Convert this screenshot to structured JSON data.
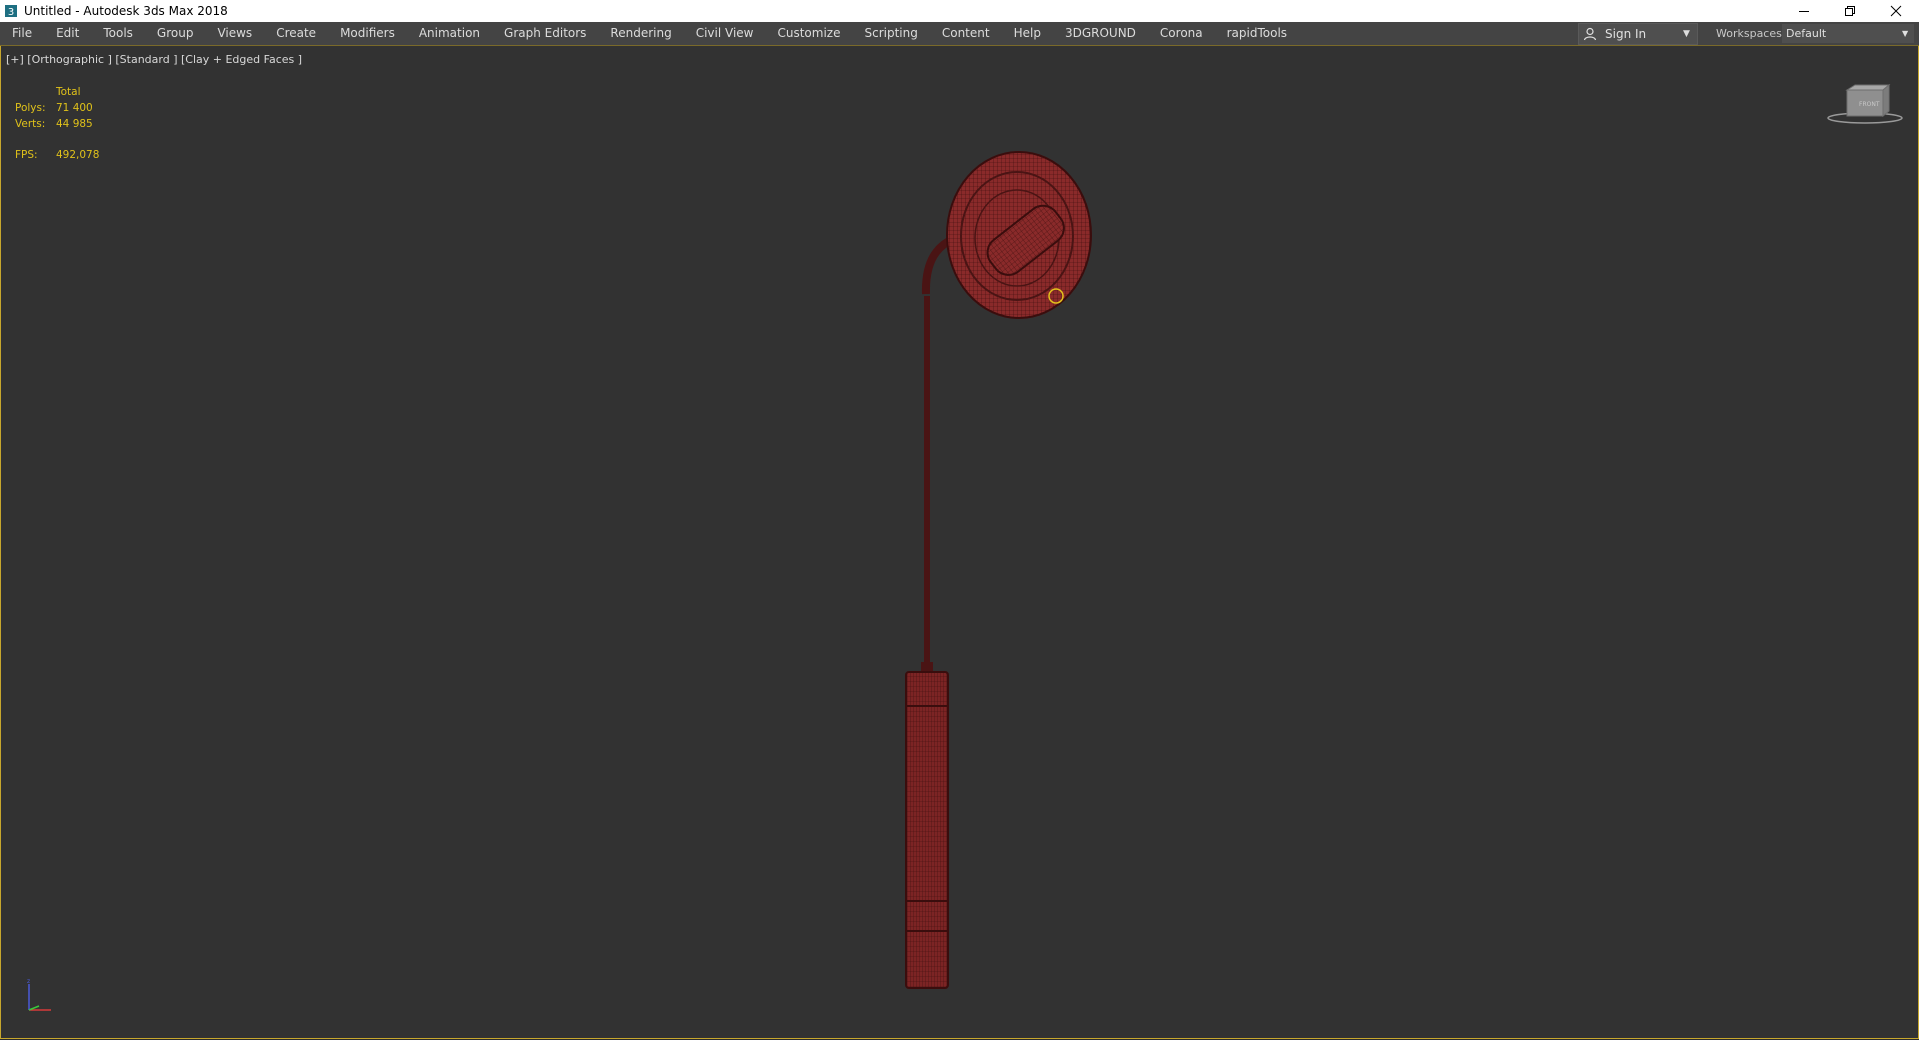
{
  "window": {
    "title": "Untitled - Autodesk 3ds Max 2018",
    "app_icon": "3ds-max-icon",
    "controls": [
      "minimize-icon",
      "restore-icon",
      "close-icon"
    ]
  },
  "menu": {
    "items": [
      "File",
      "Edit",
      "Tools",
      "Group",
      "Views",
      "Create",
      "Modifiers",
      "Animation",
      "Graph Editors",
      "Rendering",
      "Civil View",
      "Customize",
      "Scripting",
      "Content",
      "Help",
      "3DGROUND",
      "Corona",
      "rapidTools"
    ],
    "sign_in": "Sign In",
    "workspaces_label": "Workspaces:",
    "workspaces_value": "Default"
  },
  "viewport": {
    "label": "[+] [Orthographic ] [Standard ] [Clay + Edged Faces ]",
    "stats": {
      "header": "Total",
      "polys_label": "Polys:",
      "polys_value": "71 400",
      "verts_label": "Verts:",
      "verts_value": "44 985",
      "fps_label": "FPS:",
      "fps_value": "492,078"
    },
    "viewcube_icon": "viewcube-icon",
    "axis_icon": "axis-tripod-icon",
    "model_color": "#8a2a2a",
    "border_color": "#c7a72d"
  }
}
